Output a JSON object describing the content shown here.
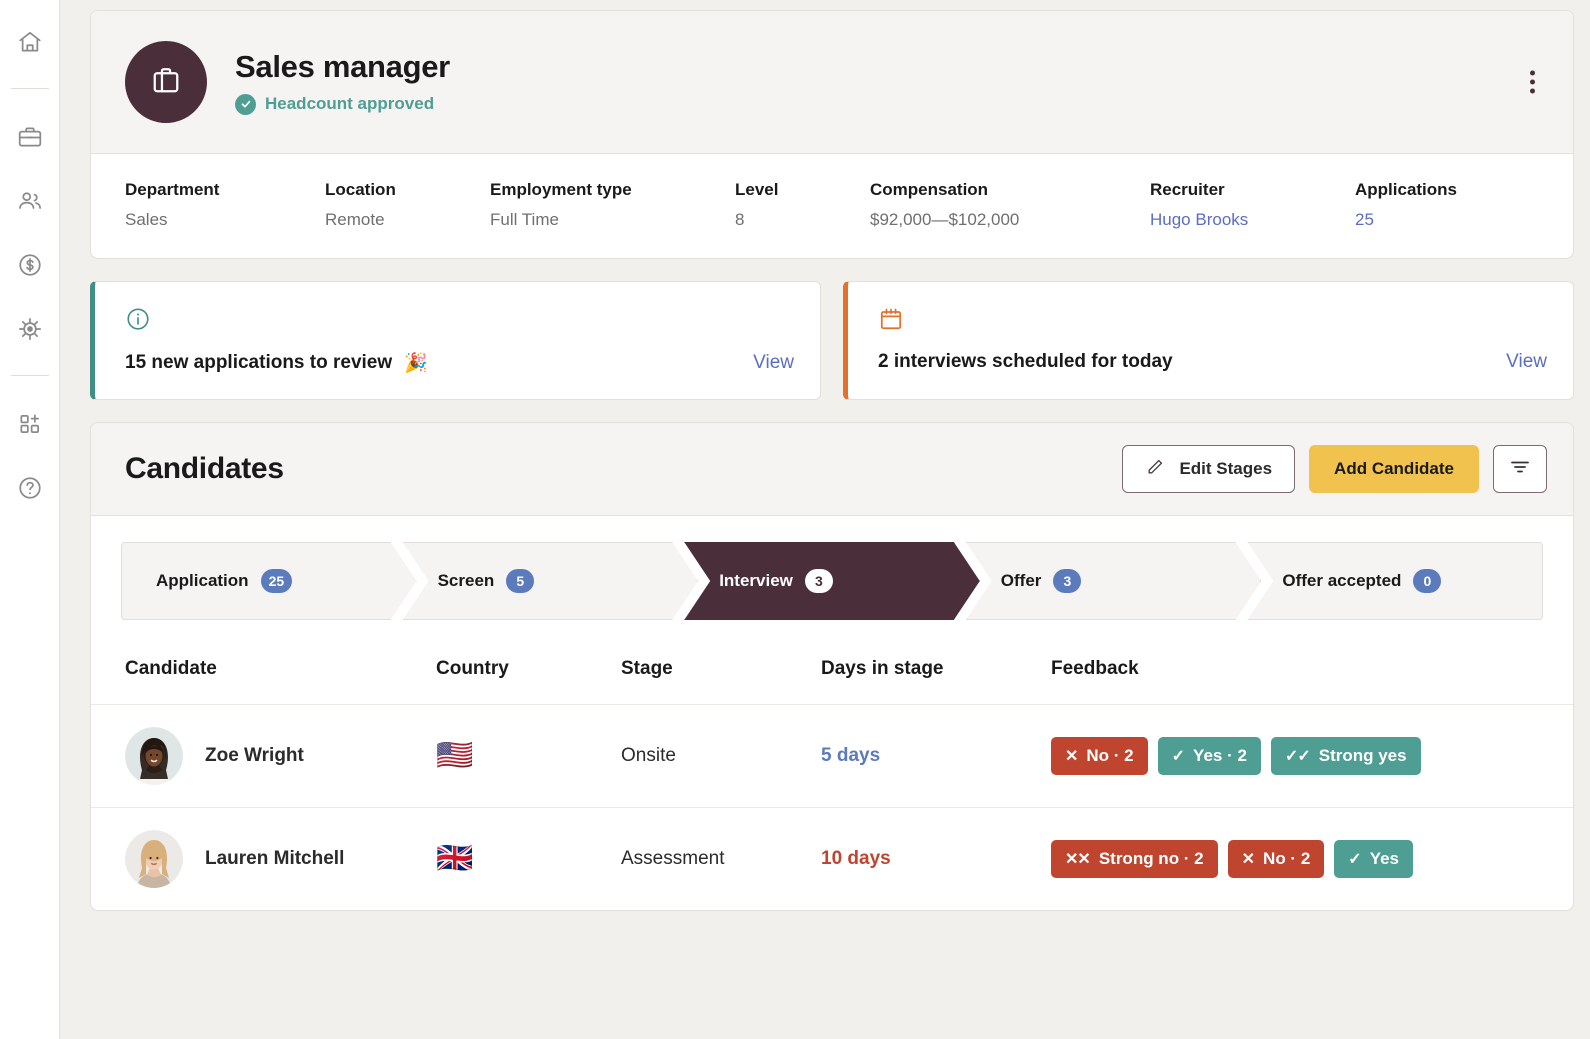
{
  "sidebar": {
    "items": [
      {
        "name": "home",
        "icon": "home-icon"
      },
      {
        "name": "jobs",
        "icon": "briefcase-icon"
      },
      {
        "name": "people",
        "icon": "people-icon"
      },
      {
        "name": "compensation",
        "icon": "dollar-circle-icon"
      },
      {
        "name": "settings",
        "icon": "gear-icon"
      },
      {
        "name": "apps",
        "icon": "grid-plus-icon"
      },
      {
        "name": "help",
        "icon": "help-circle-icon"
      }
    ]
  },
  "job": {
    "title": "Sales manager",
    "status": "Headcount approved",
    "status_color": "#4f9e94",
    "avatar_icon": "briefcase-icon",
    "menu_icon": "kebab-menu-icon",
    "meta": [
      {
        "label": "Department",
        "value": "Sales",
        "link": false
      },
      {
        "label": "Location",
        "value": "Remote",
        "link": false
      },
      {
        "label": "Employment type",
        "value": "Full Time",
        "link": false
      },
      {
        "label": "Level",
        "value": "8",
        "link": false
      },
      {
        "label": "Compensation",
        "value": "$92,000—$102,000",
        "link": false
      },
      {
        "label": "Recruiter",
        "value": "Hugo Brooks",
        "link": true
      },
      {
        "label": "Applications",
        "value": "25",
        "link": true
      }
    ]
  },
  "banners": [
    {
      "icon": "info-circle-icon",
      "accent": "#3f8f86",
      "text": "15 new applications to review",
      "emoji": "🎉",
      "link": "View"
    },
    {
      "icon": "calendar-icon",
      "accent": "#e2712a",
      "text": "2 interviews scheduled for today",
      "emoji": "",
      "link": "View"
    }
  ],
  "candidates_panel": {
    "title": "Candidates",
    "edit_stages_label": "Edit  Stages",
    "edit_stages_icon": "pencil-icon",
    "add_candidate_label": "Add Candidate",
    "add_candidate_color": "#f2c24f",
    "filter_icon": "filter-icon",
    "pipeline": [
      {
        "label": "Application",
        "count": "25",
        "active": false
      },
      {
        "label": "Screen",
        "count": "5",
        "active": false
      },
      {
        "label": "Interview",
        "count": "3",
        "active": true
      },
      {
        "label": "Offer",
        "count": "3",
        "active": false
      },
      {
        "label": "Offer accepted",
        "count": "0",
        "active": false
      }
    ],
    "columns": [
      "Candidate",
      "Country",
      "Stage",
      "Days in stage",
      "Feedback"
    ],
    "rows": [
      {
        "name": "Zoe Wright",
        "flag": "🇺🇸",
        "stage": "Onsite",
        "days": "5 days",
        "days_tone": "normal",
        "feedback": [
          {
            "mark": "✕",
            "label": "No · 2",
            "tone": "neg"
          },
          {
            "mark": "✓",
            "label": "Yes · 2",
            "tone": "pos"
          },
          {
            "mark": "✓✓",
            "label": "Strong yes",
            "tone": "pos"
          }
        ]
      },
      {
        "name": "Lauren Mitchell",
        "flag": "🇬🇧",
        "stage": "Assessment",
        "days": "10 days",
        "days_tone": "warn",
        "feedback": [
          {
            "mark": "✕✕",
            "label": "Strong no · 2",
            "tone": "neg"
          },
          {
            "mark": "✕",
            "label": "No · 2",
            "tone": "neg"
          },
          {
            "mark": "✓",
            "label": "Yes",
            "tone": "pos"
          }
        ]
      }
    ]
  }
}
